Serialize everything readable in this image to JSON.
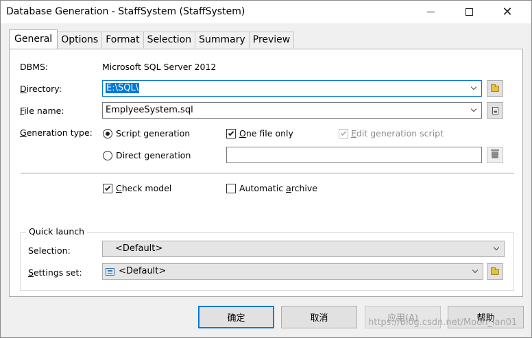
{
  "window": {
    "title": "Database Generation - StaffSystem (StaffSystem)"
  },
  "tabs": [
    {
      "label": "General",
      "active": true
    },
    {
      "label": "Options"
    },
    {
      "label": "Format"
    },
    {
      "label": "Selection"
    },
    {
      "label": "Summary"
    },
    {
      "label": "Preview"
    }
  ],
  "general": {
    "dbms_label": "DBMS:",
    "dbms_value": "Microsoft SQL Server 2012",
    "directory_label_u": "D",
    "directory_label_rest": "irectory:",
    "directory_value": "E:\\SQL\\",
    "filename_label_u": "F",
    "filename_label_rest": "ile name:",
    "filename_value": "EmplyeeSystem.sql",
    "gentype_label_u": "G",
    "gentype_label_rest": "eneration type:",
    "script_generation": "Script generation",
    "direct_generation": "Direct generation",
    "one_file_only_u": "O",
    "one_file_only_rest": "ne file only",
    "edit_script_u": "E",
    "edit_script_rest": "dit generation script",
    "check_model_u": "C",
    "check_model_rest": "heck model",
    "auto_archive_pre": "Automatic ",
    "auto_archive_u": "a",
    "auto_archive_rest": "rchive"
  },
  "quick_launch": {
    "title": "Quick launch",
    "selection_label": "Selection:",
    "selection_value": "<Default>",
    "settings_label_u": "S",
    "settings_label_rest": "ettings set:",
    "settings_value": "<Default>"
  },
  "buttons": {
    "ok": "确定",
    "cancel": "取消",
    "apply": "应用(A)",
    "help": "帮助"
  },
  "watermark": "https://blog.csdn.net/Moon_lan01",
  "colors": {
    "accent": "#0078d7",
    "dialog_bg": "#f0f0f0",
    "panel_bg": "#ffffff"
  }
}
